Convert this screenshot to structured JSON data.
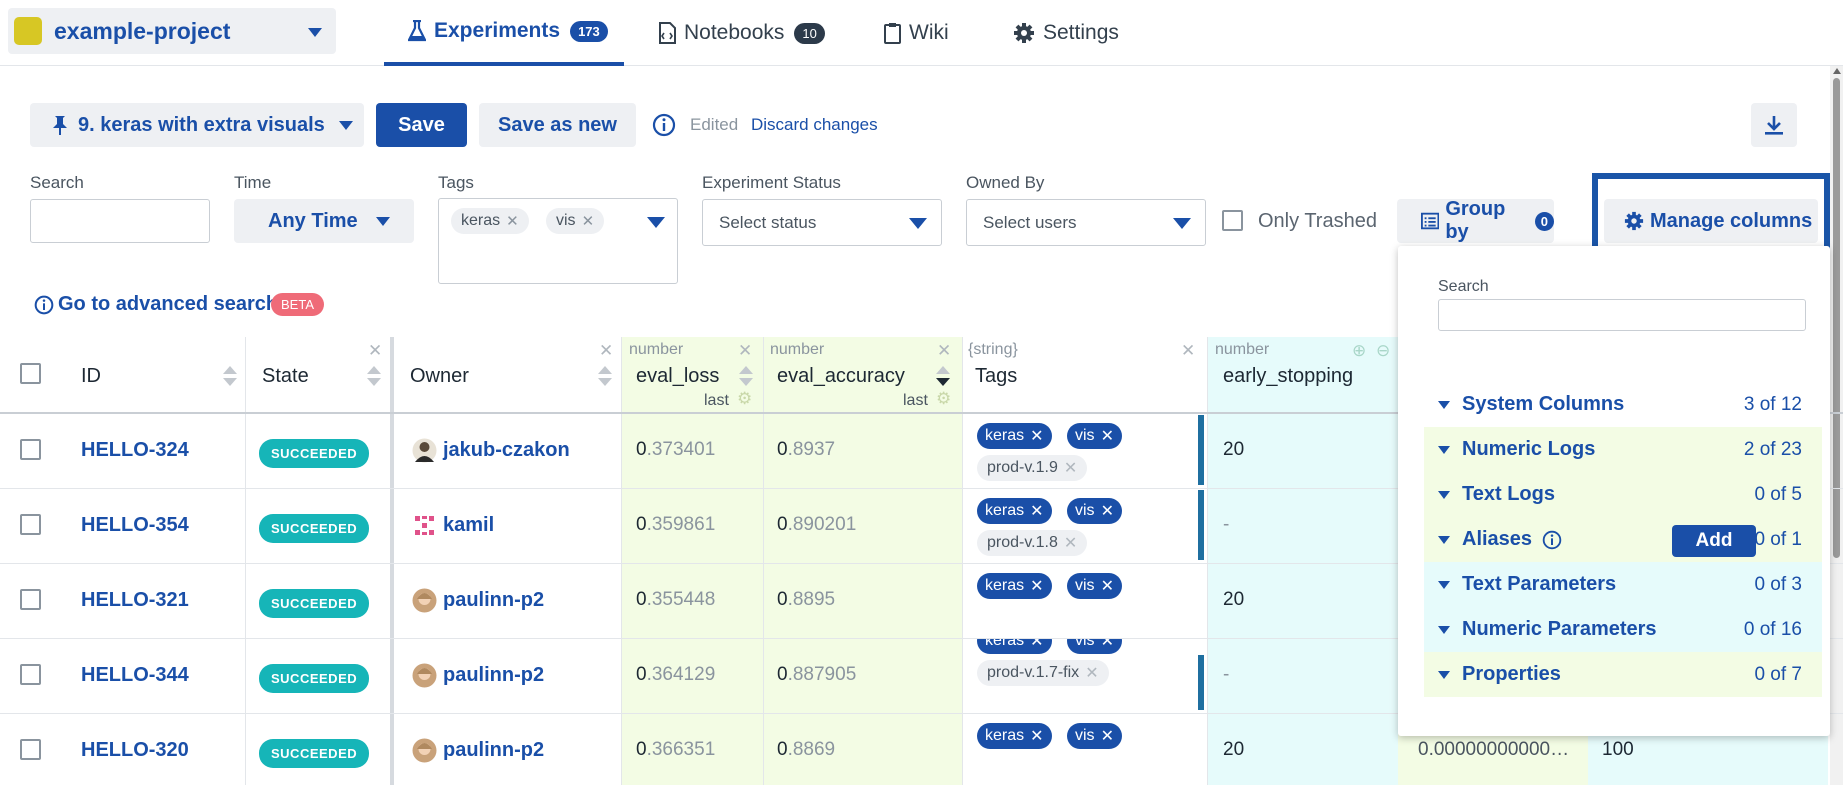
{
  "project": {
    "name": "example-project",
    "color": "#d7c724"
  },
  "nav": {
    "tabs": [
      {
        "label": "Experiments",
        "count": "173"
      },
      {
        "label": "Notebooks",
        "count": "10"
      },
      {
        "label": "Wiki"
      },
      {
        "label": "Settings"
      }
    ]
  },
  "view": {
    "name": "9. keras with extra visuals",
    "save_label": "Save",
    "save_as_label": "Save as new",
    "edited_label": "Edited",
    "discard_label": "Discard changes"
  },
  "filters": {
    "search_label": "Search",
    "time_label": "Time",
    "time_value": "Any Time",
    "tags_label": "Tags",
    "tags": [
      "keras",
      "vis"
    ],
    "status_label": "Experiment Status",
    "status_placeholder": "Select status",
    "owned_label": "Owned By",
    "owned_placeholder": "Select users",
    "trashed_label": "Only Trashed",
    "group_by_label": "Group by",
    "group_by_count": "0",
    "manage_columns_label": "Manage columns",
    "advanced_search_label": "Go to advanced search",
    "beta_label": "BETA"
  },
  "table": {
    "headers": {
      "id": "ID",
      "state": "State",
      "owner": "Owner",
      "eval_loss": {
        "type": "number",
        "name": "eval_loss",
        "agg": "last"
      },
      "eval_accuracy": {
        "type": "number",
        "name": "eval_accuracy",
        "agg": "last"
      },
      "tags": {
        "type": "{string}",
        "name": "Tags"
      },
      "early_stopping": {
        "type": "number",
        "name": "early_stopping"
      }
    },
    "rows": [
      {
        "id": "HELLO-324",
        "state": "SUCCEEDED",
        "owner": "jakub-czakon",
        "eval_loss_int": "0",
        "eval_loss_frac": ".373401",
        "eval_acc_int": "0",
        "eval_acc_frac": ".8937",
        "tags": [
          "keras",
          "vis"
        ],
        "extra_tag": "prod-v.1.9",
        "early_stopping": "20"
      },
      {
        "id": "HELLO-354",
        "state": "SUCCEEDED",
        "owner": "kamil",
        "eval_loss_int": "0",
        "eval_loss_frac": ".359861",
        "eval_acc_int": "0",
        "eval_acc_frac": ".890201",
        "tags": [
          "keras",
          "vis"
        ],
        "extra_tag": "prod-v.1.8",
        "early_stopping": "-"
      },
      {
        "id": "HELLO-321",
        "state": "SUCCEEDED",
        "owner": "paulinn-p2",
        "eval_loss_int": "0",
        "eval_loss_frac": ".355448",
        "eval_acc_int": "0",
        "eval_acc_frac": ".8895",
        "tags": [
          "keras",
          "vis"
        ],
        "extra_tag": "",
        "early_stopping": "20"
      },
      {
        "id": "HELLO-344",
        "state": "SUCCEEDED",
        "owner": "paulinn-p2",
        "eval_loss_int": "0",
        "eval_loss_frac": ".364129",
        "eval_acc_int": "0",
        "eval_acc_frac": ".887905",
        "tags": [
          "keras",
          "vis"
        ],
        "extra_tag": "prod-v.1.7-fix",
        "early_stopping": "-"
      },
      {
        "id": "HELLO-320",
        "state": "SUCCEEDED",
        "owner": "paulinn-p2",
        "eval_loss_int": "0",
        "eval_loss_frac": ".366351",
        "eval_acc_int": "0",
        "eval_acc_frac": ".8869",
        "tags": [
          "keras",
          "vis"
        ],
        "extra_tag": "",
        "early_stopping": "20",
        "hidden_numeric": "0.00000000000…",
        "hidden_param": "100"
      }
    ]
  },
  "manage_columns": {
    "search_label": "Search",
    "add_label": "Add",
    "groups": [
      {
        "label": "System Columns",
        "count": "3 of 12"
      },
      {
        "label": "Numeric Logs",
        "count": "2 of 23"
      },
      {
        "label": "Text Logs",
        "count": "0 of 5"
      },
      {
        "label": "Aliases",
        "count": "0 of 1"
      },
      {
        "label": "Text Parameters",
        "count": "0 of 3"
      },
      {
        "label": "Numeric Parameters",
        "count": "0 of 16"
      },
      {
        "label": "Properties",
        "count": "0 of 7"
      }
    ]
  },
  "colors": {
    "accent": "#1a4fa8",
    "succeeded": "#16b5b8",
    "numeric_col_bg": "#f3fce4",
    "param_col_bg": "#e6fbfb",
    "highlight_frame": "#1a55a8"
  }
}
